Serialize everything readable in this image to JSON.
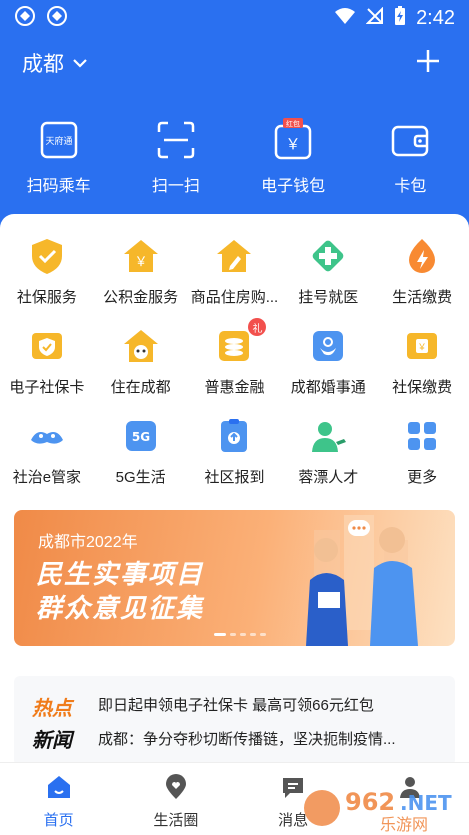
{
  "status_bar": {
    "time": "2:42"
  },
  "header": {
    "city": "成都"
  },
  "quick_actions": [
    {
      "label": "扫码乘车",
      "icon": "transit-card-icon",
      "icon_text": "天府通"
    },
    {
      "label": "扫一扫",
      "icon": "scan-icon"
    },
    {
      "label": "电子钱包",
      "icon": "wallet-icon",
      "badge": "红包"
    },
    {
      "label": "卡包",
      "icon": "card-wallet-icon"
    }
  ],
  "services": [
    {
      "label": "社保服务",
      "icon": "shield-icon"
    },
    {
      "label": "公积金服务",
      "icon": "house-fund-icon"
    },
    {
      "label": "商品住房购...",
      "icon": "house-pencil-icon"
    },
    {
      "label": "挂号就医",
      "icon": "medical-cross-icon"
    },
    {
      "label": "生活缴费",
      "icon": "lightning-icon"
    },
    {
      "label": "电子社保卡",
      "icon": "social-card-icon"
    },
    {
      "label": "住在成都",
      "icon": "panda-house-icon"
    },
    {
      "label": "普惠金融",
      "icon": "coins-icon",
      "badge": "礼"
    },
    {
      "label": "成都婚事通",
      "icon": "marriage-icon"
    },
    {
      "label": "社保缴费",
      "icon": "payment-icon"
    },
    {
      "label": "社治e管家",
      "icon": "community-icon"
    },
    {
      "label": "5G生活",
      "icon": "5g-icon"
    },
    {
      "label": "社区报到",
      "icon": "checkin-icon"
    },
    {
      "label": "蓉漂人才",
      "icon": "talent-icon"
    },
    {
      "label": "更多",
      "icon": "grid-more-icon"
    }
  ],
  "banner": {
    "small_title": "成都市2022年",
    "line1": "民生实事项目",
    "line2": "群众意见征集"
  },
  "news": {
    "tag_top": "热点",
    "tag_bottom": "新闻",
    "items": [
      "即日起申领电子社保卡 最高可领66元红包",
      "成都：争分夺秒切断传播链，坚决扼制疫情..."
    ]
  },
  "tabs": [
    {
      "label": "首页",
      "icon": "home-icon",
      "active": true
    },
    {
      "label": "生活圈",
      "icon": "location-heart-icon",
      "active": false
    },
    {
      "label": "消息",
      "icon": "message-icon",
      "active": false
    },
    {
      "label": "",
      "icon": "profile-icon",
      "active": false
    }
  ],
  "watermark": "962.NET 乐游网",
  "colors": {
    "primary": "#2a70f0",
    "orange": "#f08a47",
    "yellow": "#f6b72a"
  }
}
